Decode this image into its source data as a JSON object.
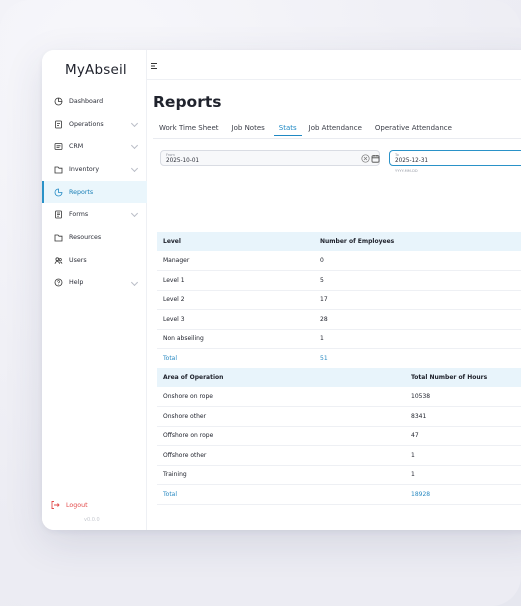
{
  "app": {
    "brand": "MyAbseil",
    "version": "v0.0.0"
  },
  "sidebar": {
    "items": [
      {
        "label": "Dashboard",
        "icon": "dashboard-icon",
        "chevron": false,
        "active": false
      },
      {
        "label": "Operations",
        "icon": "operations-icon",
        "chevron": true,
        "active": false
      },
      {
        "label": "CRM",
        "icon": "crm-icon",
        "chevron": true,
        "active": false
      },
      {
        "label": "Inventory",
        "icon": "folder-icon",
        "chevron": true,
        "active": false
      },
      {
        "label": "Reports",
        "icon": "reports-icon",
        "chevron": false,
        "active": true
      },
      {
        "label": "Forms",
        "icon": "forms-icon",
        "chevron": true,
        "active": false
      },
      {
        "label": "Resources",
        "icon": "folder-icon",
        "chevron": false,
        "active": false
      },
      {
        "label": "Users",
        "icon": "users-icon",
        "chevron": false,
        "active": false
      },
      {
        "label": "Help",
        "icon": "help-icon",
        "chevron": true,
        "active": false
      }
    ],
    "logout": "Logout"
  },
  "page": {
    "title": "Reports",
    "tabs": [
      {
        "label": "Work Time Sheet",
        "active": false
      },
      {
        "label": "Job Notes",
        "active": false
      },
      {
        "label": "Stats",
        "active": true
      },
      {
        "label": "Job Attendance",
        "active": false
      },
      {
        "label": "Operative Attendance",
        "active": false
      }
    ]
  },
  "filters": {
    "from": {
      "label": "From",
      "value": "2025-10-01"
    },
    "to": {
      "label": "To",
      "value": "2025-12-31",
      "hint": "YYYY-MM-DD"
    }
  },
  "levels_table": {
    "headers": [
      "Level",
      "Number of Employees"
    ],
    "rows": [
      [
        "Manager",
        "0"
      ],
      [
        "Level 1",
        "5"
      ],
      [
        "Level 2",
        "17"
      ],
      [
        "Level 3",
        "28"
      ],
      [
        "Non abseiling",
        "1"
      ]
    ],
    "total": [
      "Total",
      "51"
    ]
  },
  "operations_table": {
    "headers": [
      "Area of Operation",
      "Total Number of Hours"
    ],
    "rows": [
      [
        "Onshore on rope",
        "10538"
      ],
      [
        "Onshore other",
        "8341"
      ],
      [
        "Offshore on rope",
        "47"
      ],
      [
        "Offshore other",
        "1"
      ],
      [
        "Training",
        "1"
      ]
    ],
    "total": [
      "Total",
      "18928"
    ]
  },
  "colors": {
    "accent": "#2089c4",
    "active_bg": "#eaf6fc",
    "header_bg": "#e8f4fb",
    "logout": "#e34b4b"
  }
}
